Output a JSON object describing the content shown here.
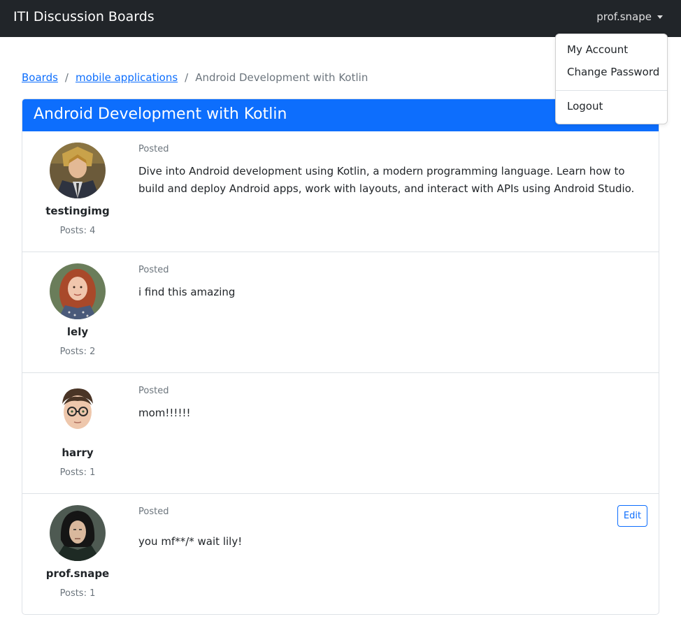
{
  "navbar": {
    "brand": "ITI Discussion Boards",
    "user": "prof.snape"
  },
  "dropdown": {
    "items": [
      "My Account",
      "Change Password",
      "Logout"
    ]
  },
  "breadcrumb": {
    "boards": "Boards",
    "category": "mobile applications",
    "current": "Android Development with Kotlin",
    "separator": "/"
  },
  "topic": {
    "title": "Android Development with Kotlin"
  },
  "posts": [
    {
      "username": "testingimg",
      "count": "Posts: 4",
      "posted": "Posted",
      "message": "Dive into Android development using Kotlin, a modern programming language. Learn how to build and deploy Android apps, work with layouts, and interact with APIs using Android Studio.",
      "avatar_icon": "avatar-anime-soldier"
    },
    {
      "username": "lely",
      "count": "Posts: 2",
      "posted": "Posted",
      "message": "i find this amazing",
      "avatar_icon": "avatar-red-hair-girl"
    },
    {
      "username": "harry",
      "count": "Posts: 1",
      "posted": "Posted",
      "message": "mom!!!!!!",
      "avatar_icon": "avatar-boy-glasses"
    },
    {
      "username": "prof.snape",
      "count": "Posts: 1",
      "posted": "Posted",
      "message": "you mf**/* wait lily!",
      "avatar_icon": "avatar-dark-hair-man",
      "edit_label": "Edit"
    }
  ],
  "colors": {
    "navbar": "#212529",
    "primary": "#0d6efd",
    "muted": "#6c757d"
  }
}
